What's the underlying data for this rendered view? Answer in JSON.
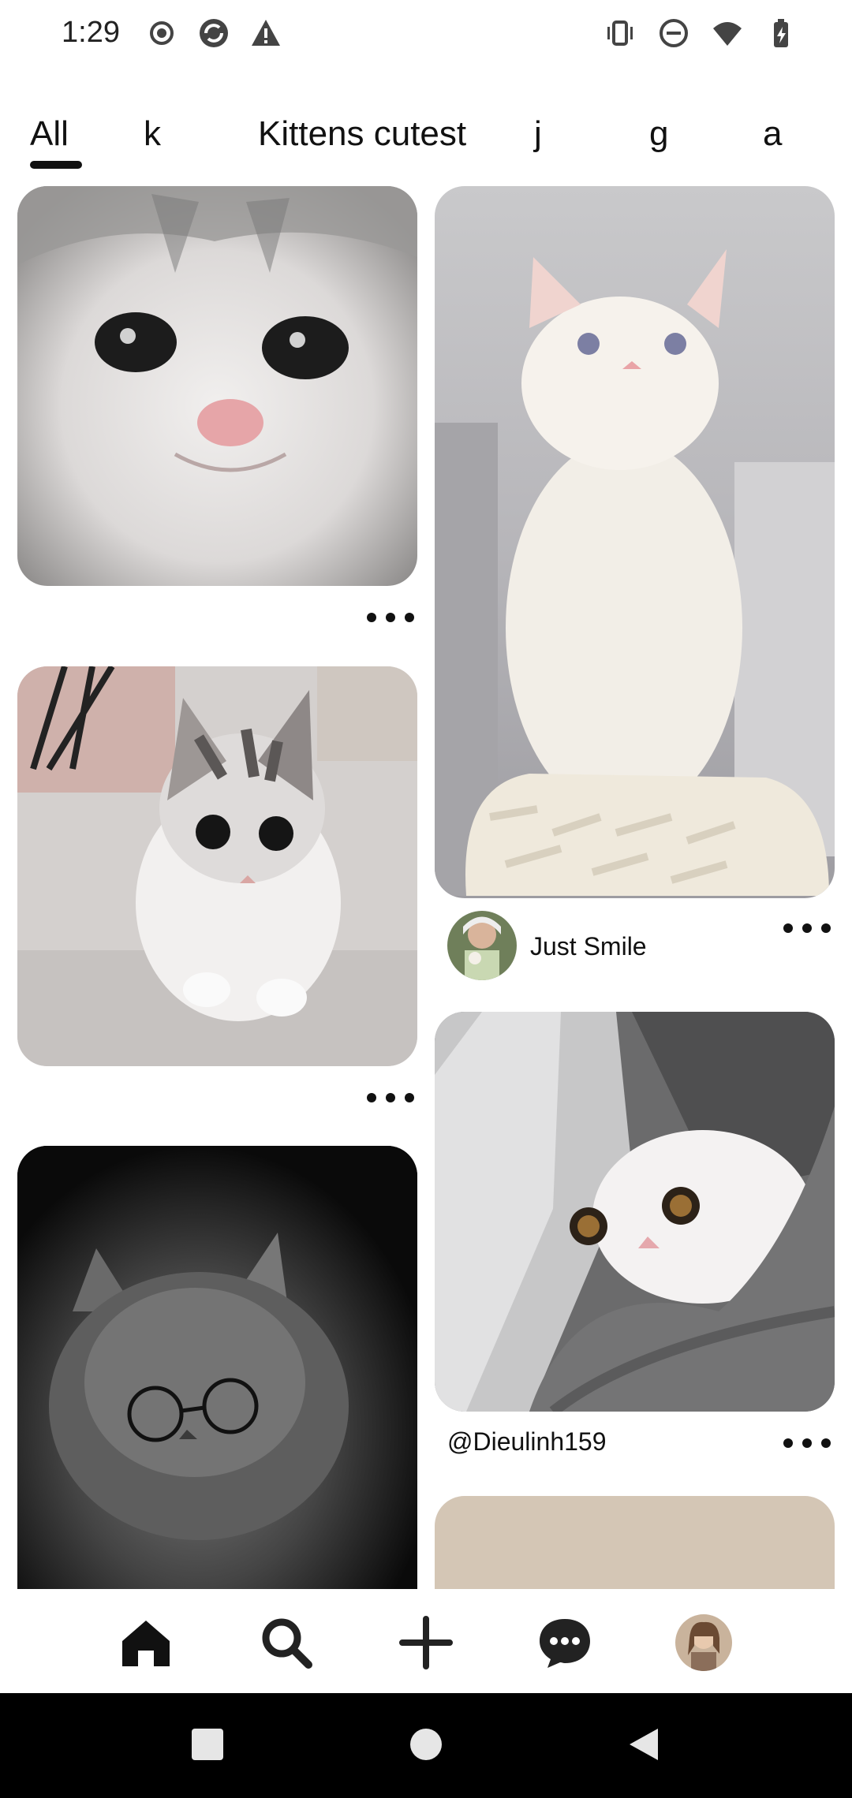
{
  "status_bar": {
    "time": "1:29",
    "left_icons": [
      "record-icon",
      "sync-icon",
      "warning-icon"
    ],
    "right_icons": [
      "vibrate-icon",
      "do-not-disturb-icon",
      "wifi-icon",
      "battery-charging-icon"
    ]
  },
  "tabs": [
    {
      "label": "All",
      "selected": true
    },
    {
      "label": "k"
    },
    {
      "label": "Kittens cutest"
    },
    {
      "label": "j"
    },
    {
      "label": "g"
    },
    {
      "label": "a"
    }
  ],
  "pins": [
    {
      "column": "left",
      "description_icon": "kitten-closeup-image"
    },
    {
      "column": "right",
      "author": "Just Smile",
      "description_icon": "white-kitten-sitting-image"
    },
    {
      "column": "left",
      "description_icon": "kitten-walking-image"
    },
    {
      "column": "right",
      "author": "@Dieulinh159",
      "description_icon": "kitten-in-blanket-image"
    },
    {
      "column": "left",
      "description_icon": "kitten-with-glasses-image"
    },
    {
      "column": "right",
      "description_icon": "partial-image"
    }
  ],
  "bottom_nav": {
    "items": [
      "home-icon",
      "search-icon",
      "create-icon",
      "messages-icon",
      "profile-avatar"
    ]
  },
  "colors": {
    "accent": "#111111",
    "background": "#ffffff",
    "system_nav": "#000000"
  }
}
